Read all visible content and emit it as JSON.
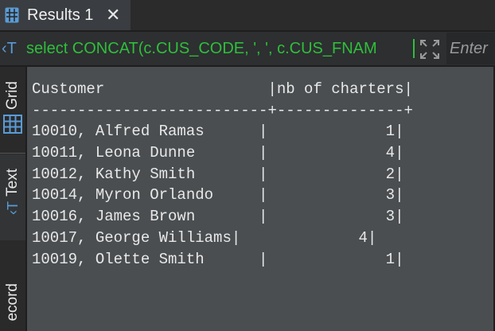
{
  "tab": {
    "title": "Results 1",
    "close": "✕"
  },
  "query": {
    "text": "select CONCAT(c.CUS_CODE, ', ', c.CUS_FNAM",
    "enter_label": "Enter"
  },
  "sidebar": {
    "items": [
      {
        "label": "Grid"
      },
      {
        "label": "Text"
      },
      {
        "label": "ecord"
      }
    ]
  },
  "results": {
    "header": "Customer                  |nb of charters|",
    "separator": "--------------------------+--------------+",
    "rows": [
      "10010, Alfred Ramas      |             1|",
      "10011, Leona Dunne       |             4|",
      "10012, Kathy Smith       |             2|",
      "10014, Myron Orlando     |             3|",
      "10016, James Brown       |             3|",
      "10017, George Williams|             4|",
      "10019, Olette Smith      |             1|"
    ]
  },
  "colors": {
    "query_text": "#2fbf3a",
    "icon_blue": "#5a9bd5",
    "panel_bg": "#4a4e51"
  }
}
